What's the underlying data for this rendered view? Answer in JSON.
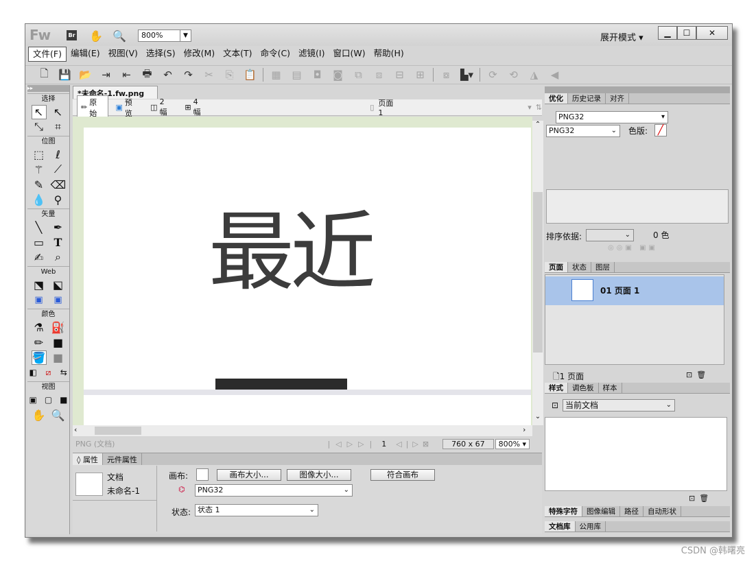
{
  "app": {
    "logo": "Fw",
    "bridge": "Br",
    "zoom": "800%",
    "mode": "展开模式"
  },
  "menus": [
    "文件(F)",
    "编辑(E)",
    "视图(V)",
    "选择(S)",
    "修改(M)",
    "文本(T)",
    "命令(C)",
    "滤镜(I)",
    "窗口(W)",
    "帮助(H)"
  ],
  "tools": {
    "select_label": "选择",
    "bitmap_label": "位图",
    "vector_label": "矢量",
    "web_label": "Web",
    "color_label": "颜色",
    "view_label": "视图"
  },
  "document": {
    "tab_title": "*未命名-1.fw.png",
    "tab_close": "×",
    "views": [
      "原始",
      "预览",
      "2 幅",
      "4 幅"
    ],
    "page_label": "页面 1",
    "canvas_text": "最近",
    "status_format": "PNG (文档)",
    "frame_num": "1",
    "canvas_size": "760 x 67",
    "zoom": "800%"
  },
  "properties": {
    "tabs": [
      "属性",
      "元件属性"
    ],
    "doc_type": "文档",
    "doc_name": "未命名-1",
    "canvas_label": "画布:",
    "canvas_size_btn": "画布大小...",
    "image_size_btn": "图像大小...",
    "fit_canvas_btn": "符合画布",
    "format_value": "PNG32",
    "state_label": "状态:",
    "state_value": "状态 1"
  },
  "right": {
    "opt_tabs": [
      "优化",
      "历史记录",
      "对齐"
    ],
    "opt_preset": "PNG32",
    "opt_format": "PNG32",
    "palette_label": "色版:",
    "sort_label": "排序依据:",
    "color_count": "0 色",
    "page_tabs": [
      "页面",
      "状态",
      "图层"
    ],
    "page_item": "01 页面 1",
    "page_count": "1 页面",
    "style_tabs": [
      "样式",
      "调色板",
      "样本"
    ],
    "style_source": "当前文档",
    "bottom_tabs": [
      "特殊字符",
      "图像编辑",
      "路径",
      "自动形状"
    ],
    "bottom_tabs2": [
      "文档库",
      "公用库"
    ]
  },
  "watermark": "CSDN @韩曙亮"
}
